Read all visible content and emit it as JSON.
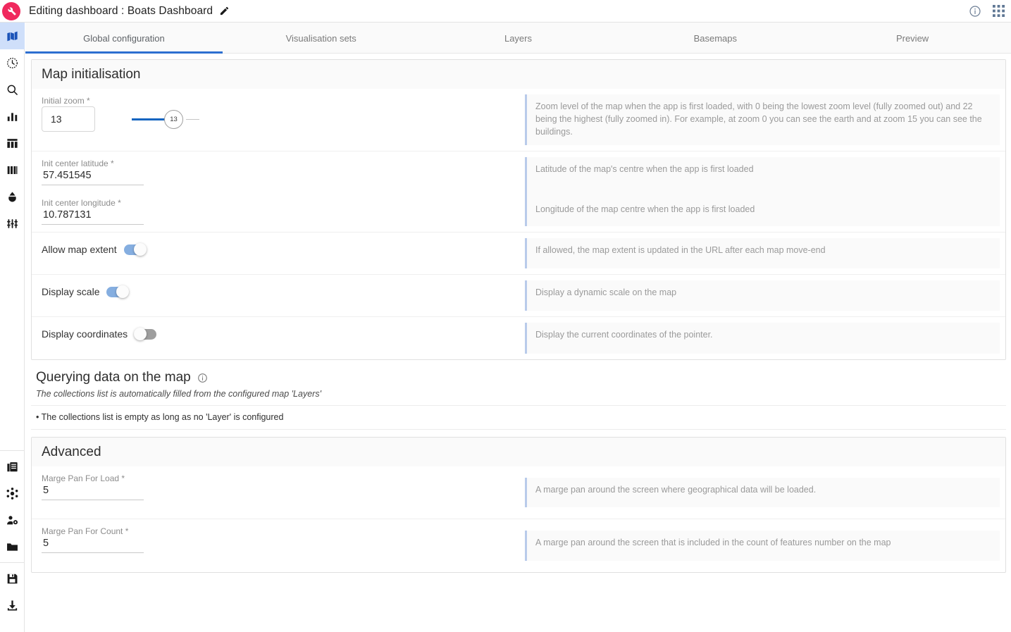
{
  "topbar": {
    "logo_icon": "wrench-logo-icon",
    "logo_color": "#f0295e",
    "title": "Editing dashboard : Boats Dashboard",
    "edit_icon": "pencil-icon",
    "info_icon": "info-circle-icon",
    "apps_icon": "apps-grid-icon"
  },
  "sidebar": {
    "items": [
      {
        "name": "map",
        "icon": "map-icon",
        "active": true
      },
      {
        "name": "timeline",
        "icon": "clock-history-icon",
        "active": false
      },
      {
        "name": "search",
        "icon": "search-icon",
        "active": false
      },
      {
        "name": "analytics",
        "icon": "bar-chart-icon",
        "active": false
      },
      {
        "name": "table",
        "icon": "table-icon",
        "active": false
      },
      {
        "name": "columns",
        "icon": "columns-icon",
        "active": false
      },
      {
        "name": "shape",
        "icon": "water-drop-icon",
        "active": false
      },
      {
        "name": "filters",
        "icon": "sliders-icon",
        "active": false
      }
    ],
    "bottom_items": [
      {
        "name": "documents",
        "icon": "documents-icon"
      },
      {
        "name": "hub",
        "icon": "network-hub-icon"
      },
      {
        "name": "user-settings",
        "icon": "user-gear-icon"
      },
      {
        "name": "folder",
        "icon": "folder-icon"
      },
      {
        "name": "save",
        "icon": "floppy-save-icon"
      },
      {
        "name": "download",
        "icon": "download-icon"
      }
    ]
  },
  "tabs": [
    {
      "label": "Global configuration",
      "active": true
    },
    {
      "label": "Visualisation sets",
      "active": false
    },
    {
      "label": "Layers",
      "active": false
    },
    {
      "label": "Basemaps",
      "active": false
    },
    {
      "label": "Preview",
      "active": false
    }
  ],
  "map_init": {
    "heading": "Map initialisation",
    "initial_zoom": {
      "label": "Initial zoom *",
      "value": "13",
      "slider_value": "13",
      "help": "Zoom level of the map when the app is first loaded, with 0 being the lowest zoom level (fully zoomed out) and 22 being the highest (fully zoomed in). For example, at zoom 0 you can see the earth and at zoom 15 you can see the buildings."
    },
    "latitude": {
      "label": "Init center latitude *",
      "value": "57.451545",
      "help": "Latitude of the map's centre when the app is first loaded"
    },
    "longitude": {
      "label": "Init center longitude *",
      "value": "10.787131",
      "help": "Longitude of the map centre when the app is first loaded"
    },
    "allow_map_extent": {
      "label": "Allow map extent",
      "state": "on",
      "help": "If allowed, the map extent is updated in the URL after each map move-end"
    },
    "display_scale": {
      "label": "Display scale",
      "state": "on",
      "help": "Display a dynamic scale on the map"
    },
    "display_coordinates": {
      "label": "Display coordinates",
      "state": "off",
      "help": "Display the current coordinates of the pointer."
    }
  },
  "querying": {
    "heading": "Querying data on the map",
    "info_icon": "info-circle-icon",
    "subtitle": "The collections list is automatically filled from the configured map 'Layers'",
    "bullet": "• The collections list is empty as long as no 'Layer' is configured"
  },
  "advanced": {
    "heading": "Advanced",
    "marge_pan_load": {
      "label": "Marge Pan For Load *",
      "value": "5",
      "help": "A marge pan around the screen where geographical data will be loaded."
    },
    "marge_pan_count": {
      "label": "Marge Pan For Count *",
      "value": "5",
      "help": "A marge pan around the screen that is included in the count of features number on the map"
    }
  },
  "colors": {
    "accent_blue": "#2d6fd0",
    "brand_pink": "#f0295e",
    "toggle_on": "#85aee0",
    "help_border": "#b9cbea"
  }
}
